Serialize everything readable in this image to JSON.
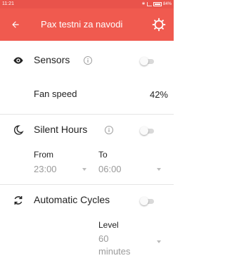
{
  "status_bar": {
    "time": "11:21",
    "battery": "84%"
  },
  "app_bar": {
    "title": "Pax testni za navodi"
  },
  "sensors": {
    "label": "Sensors",
    "enabled": false
  },
  "fan_speed": {
    "label": "Fan speed",
    "value": "42%"
  },
  "silent_hours": {
    "label": "Silent Hours",
    "enabled": false,
    "from_label": "From",
    "from_value": "23:00",
    "to_label": "To",
    "to_value": "06:00"
  },
  "automatic_cycles": {
    "label": "Automatic Cycles",
    "enabled": false,
    "level_label": "Level",
    "level_value_1": "60",
    "level_value_2": "minutes"
  }
}
